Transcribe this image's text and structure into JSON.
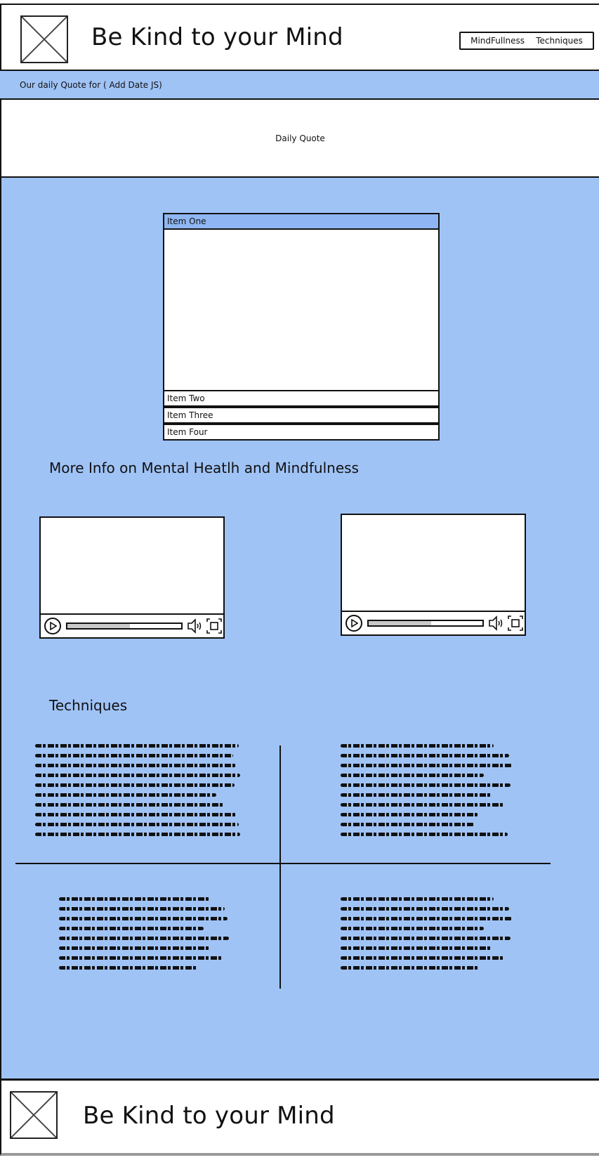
{
  "header": {
    "title": "Be Kind to your Mind",
    "logo_icon": "image-placeholder-icon",
    "nav": [
      {
        "label": "MindFullness"
      },
      {
        "label": "Techniques"
      }
    ]
  },
  "quote_bar": {
    "text": "Our daily Quote for ( Add Date JS)"
  },
  "quote_box": {
    "text": "Daily Quote"
  },
  "accordion": {
    "items": [
      {
        "label": "Item One",
        "expanded": true
      },
      {
        "label": "Item Two",
        "expanded": false
      },
      {
        "label": "Item Three",
        "expanded": false
      },
      {
        "label": "Item Four",
        "expanded": false
      }
    ]
  },
  "more_info": {
    "title": "More Info on Mental Heatlh and Mindfulness"
  },
  "videos": [
    {
      "progress": 0.55
    },
    {
      "progress": 0.55
    }
  ],
  "techniques": {
    "title": "Techniques"
  },
  "footer": {
    "title": "Be Kind to your Mind",
    "logo_icon": "image-placeholder-icon"
  },
  "colors": {
    "accent_blue": "#a0c3f6",
    "active_item": "#8fb6f2",
    "border": "#111111"
  }
}
